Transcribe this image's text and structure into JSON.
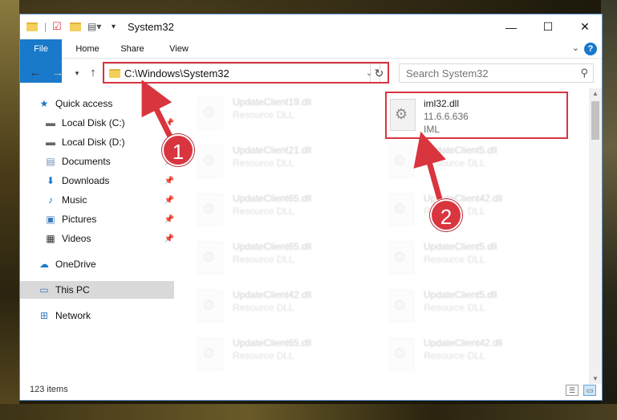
{
  "window": {
    "title": "System32",
    "controls": {
      "minimize": "—",
      "maximize": "☐",
      "close": "✕"
    }
  },
  "ribbon": {
    "tabs": [
      "File",
      "Home",
      "Share",
      "View"
    ],
    "help": "?"
  },
  "nav": {
    "address": "C:\\Windows\\System32",
    "search_placeholder": "Search System32"
  },
  "sidebar": {
    "items": [
      {
        "label": "Quick access",
        "icon": "star-icon",
        "pinned": false
      },
      {
        "label": "Local Disk (C:)",
        "icon": "drive-icon",
        "pinned": true
      },
      {
        "label": "Local Disk (D:)",
        "icon": "drive-icon",
        "pinned": true
      },
      {
        "label": "Documents",
        "icon": "documents-icon",
        "pinned": true
      },
      {
        "label": "Downloads",
        "icon": "download-icon",
        "pinned": true
      },
      {
        "label": "Music",
        "icon": "music-icon",
        "pinned": true
      },
      {
        "label": "Pictures",
        "icon": "pictures-icon",
        "pinned": true
      },
      {
        "label": "Videos",
        "icon": "videos-icon",
        "pinned": true
      },
      {
        "label": "OneDrive",
        "icon": "cloud-icon",
        "pinned": false
      },
      {
        "label": "This PC",
        "icon": "computer-icon",
        "pinned": false,
        "selected": true
      },
      {
        "label": "Network",
        "icon": "network-icon",
        "pinned": false
      }
    ]
  },
  "files": {
    "highlighted": {
      "name": "iml32.dll",
      "version": "11.6.6.636",
      "type": "IML"
    },
    "background": [
      {
        "name": "UpdateClient19.dll",
        "type": "Resource DLL"
      },
      {
        "name": "UpdateClient21.dll",
        "type": "Resource DLL"
      },
      {
        "name": "UpdateClient5.dll",
        "type": "Resource DLL"
      },
      {
        "name": "UpdateClient65.dll",
        "type": "Resource DLL"
      },
      {
        "name": "UpdateClient42.dll",
        "type": "Resource DLL"
      },
      {
        "name": "UpdateClient65.dll",
        "type": "Resource DLL"
      },
      {
        "name": "UpdateClient5.dll",
        "type": "Resource DLL"
      },
      {
        "name": "UpdateClient42.dll",
        "type": "Resource DLL"
      },
      {
        "name": "UpdateClient5.dll",
        "type": "Resource DLL"
      },
      {
        "name": "UpdateClient65.dll",
        "type": "Resource DLL"
      },
      {
        "name": "UpdateClient42.dll",
        "type": "Resource DLL"
      }
    ]
  },
  "status": {
    "item_count": "123 items"
  },
  "annotations": {
    "step1": "1",
    "step2": "2",
    "color": "#d9353f"
  }
}
